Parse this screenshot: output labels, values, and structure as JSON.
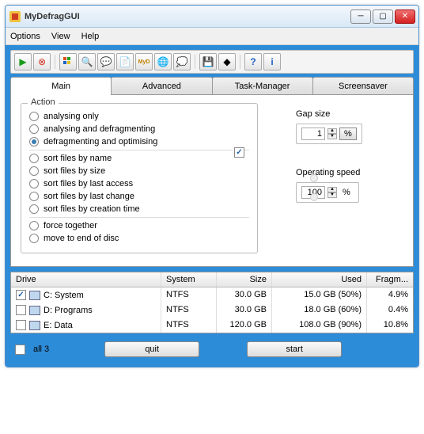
{
  "window": {
    "title": "MyDefragGUI"
  },
  "menu": {
    "options": "Options",
    "view": "View",
    "help": "Help"
  },
  "tabs": {
    "main": "Main",
    "advanced": "Advanced",
    "taskmgr": "Task-Manager",
    "screensaver": "Screensaver"
  },
  "action": {
    "legend": "Action",
    "items": [
      "analysing only",
      "analysing and defragmenting",
      "defragmenting and optimising",
      "sort files by name",
      "sort files by size",
      "sort files by last access",
      "sort files by last change",
      "sort files by creation time",
      "force together",
      "move to end of disc"
    ],
    "selectedIndex": 2
  },
  "gap": {
    "label": "Gap size",
    "value": "1",
    "unit": "%"
  },
  "speed": {
    "label": "Operating speed",
    "value": "100",
    "unit": "%"
  },
  "drives": {
    "headers": {
      "drive": "Drive",
      "system": "System",
      "size": "Size",
      "used": "Used",
      "frag": "Fragm..."
    },
    "rows": [
      {
        "checked": true,
        "name": "C: System",
        "system": "NTFS",
        "size": "30.0 GB",
        "used": "15.0 GB (50%)",
        "frag": "4.9%"
      },
      {
        "checked": false,
        "name": "D: Programs",
        "system": "NTFS",
        "size": "30.0 GB",
        "used": "18.0 GB (60%)",
        "frag": "0.4%"
      },
      {
        "checked": false,
        "name": "E: Data",
        "system": "NTFS",
        "size": "120.0 GB",
        "used": "108.0 GB (90%)",
        "frag": "10.8%"
      }
    ]
  },
  "bottom": {
    "allLabel": "all 3",
    "quit": "quit",
    "start": "start"
  },
  "toolbarIcons": [
    "play",
    "stop",
    "grid",
    "search",
    "balloon",
    "note",
    "myd",
    "globe",
    "cloud",
    "save",
    "diamond",
    "help",
    "info"
  ]
}
